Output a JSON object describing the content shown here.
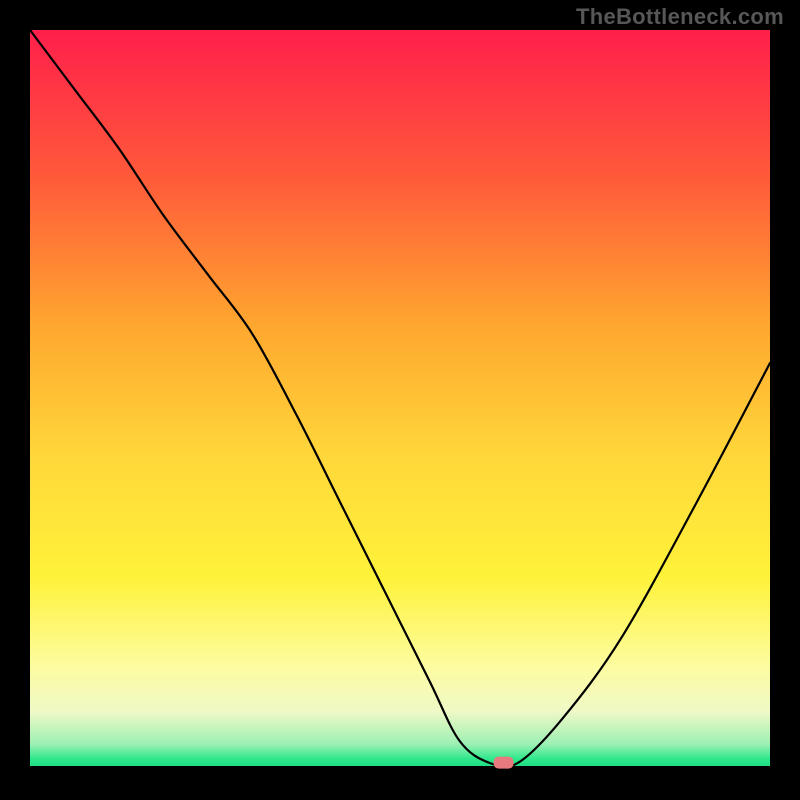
{
  "watermark": "TheBottleneck.com",
  "chart_data": {
    "type": "line",
    "title": "",
    "xlabel": "",
    "ylabel": "",
    "xlim": [
      0,
      100
    ],
    "ylim": [
      0,
      100
    ],
    "x": [
      0,
      6,
      12,
      18,
      24,
      30,
      36,
      42,
      48,
      54,
      58,
      62,
      66,
      72,
      80,
      90,
      100
    ],
    "values": [
      100,
      92,
      84,
      75,
      67,
      59,
      48,
      36,
      24,
      12,
      4,
      1,
      1,
      7,
      18,
      36,
      55
    ],
    "marker": {
      "x": 64,
      "y": 1
    },
    "gradient_stops": [
      {
        "offset": 0.0,
        "color": "#ff1f4b"
      },
      {
        "offset": 0.2,
        "color": "#ff5a3a"
      },
      {
        "offset": 0.4,
        "color": "#ffa72f"
      },
      {
        "offset": 0.58,
        "color": "#ffd83a"
      },
      {
        "offset": 0.74,
        "color": "#fff23a"
      },
      {
        "offset": 0.86,
        "color": "#fdfca0"
      },
      {
        "offset": 0.92,
        "color": "#f0f9c6"
      },
      {
        "offset": 0.965,
        "color": "#9df0b4"
      },
      {
        "offset": 0.985,
        "color": "#2ee88d"
      },
      {
        "offset": 1.0,
        "color": "#17d97c"
      }
    ],
    "marker_color": "#e77a7e",
    "curve_color": "#000000"
  }
}
